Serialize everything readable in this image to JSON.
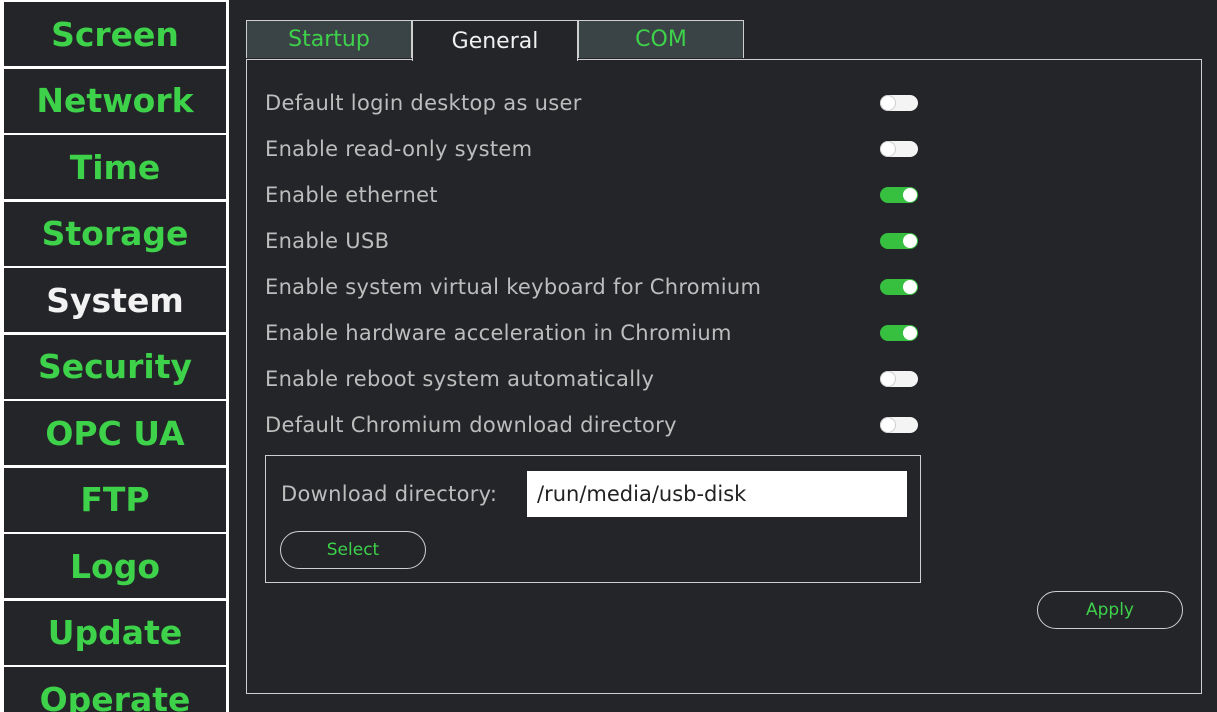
{
  "sidebar": {
    "items": [
      {
        "label": "Screen",
        "active": false
      },
      {
        "label": "Network",
        "active": false
      },
      {
        "label": "Time",
        "active": false
      },
      {
        "label": "Storage",
        "active": false
      },
      {
        "label": "System",
        "active": true
      },
      {
        "label": "Security",
        "active": false
      },
      {
        "label": "OPC UA",
        "active": false
      },
      {
        "label": "FTP",
        "active": false
      },
      {
        "label": "Logo",
        "active": false
      },
      {
        "label": "Update",
        "active": false
      },
      {
        "label": "Operate",
        "active": false
      }
    ]
  },
  "tabs": [
    {
      "label": "Startup",
      "active": false
    },
    {
      "label": "General",
      "active": true
    },
    {
      "label": "COM",
      "active": false
    }
  ],
  "settings": [
    {
      "label": "Default login desktop as user",
      "enabled": false
    },
    {
      "label": "Enable read-only system",
      "enabled": false
    },
    {
      "label": "Enable ethernet",
      "enabled": true
    },
    {
      "label": "Enable USB",
      "enabled": true
    },
    {
      "label": "Enable system virtual keyboard for Chromium",
      "enabled": true
    },
    {
      "label": "Enable hardware acceleration in Chromium",
      "enabled": true
    },
    {
      "label": "Enable reboot system automatically",
      "enabled": false
    },
    {
      "label": "Default Chromium download directory",
      "enabled": false
    }
  ],
  "download": {
    "label": "Download directory:",
    "value": "/run/media/usb-disk",
    "select_label": "Select"
  },
  "apply_label": "Apply",
  "colors": {
    "accent_green": "#3ed14a",
    "background": "#232528",
    "text_muted": "#bdbdbd"
  }
}
